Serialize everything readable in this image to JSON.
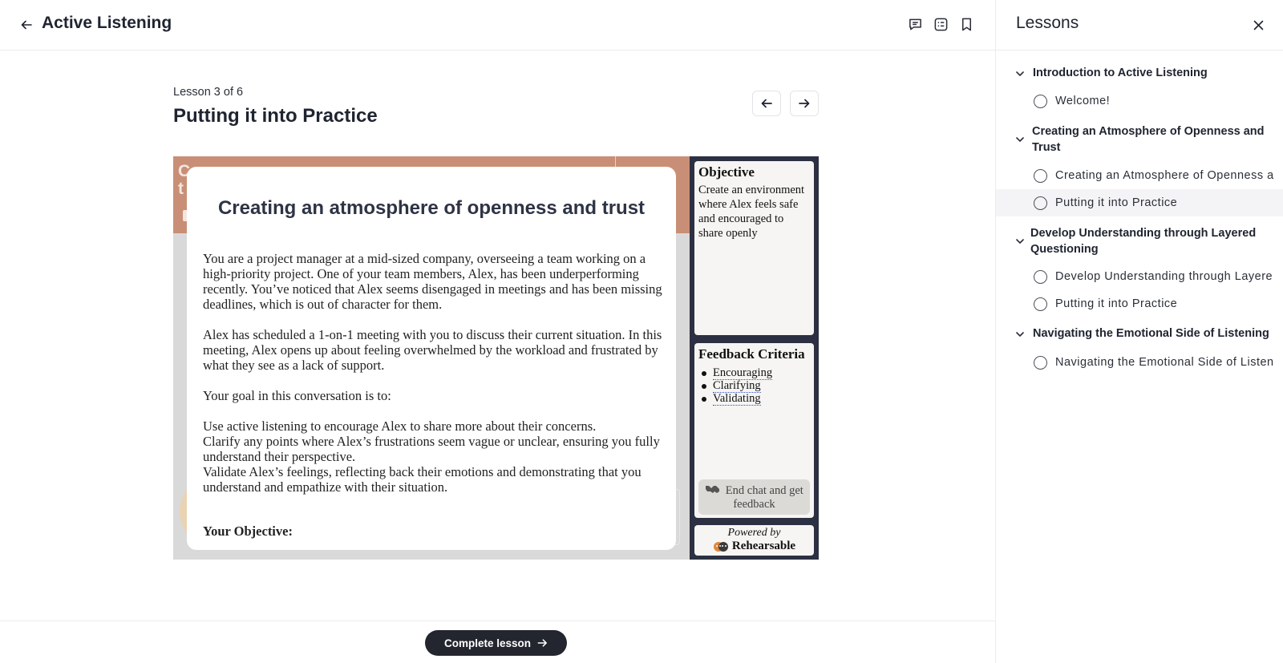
{
  "header": {
    "course_title": "Active Listening",
    "icons": [
      "back-arrow-icon",
      "comment-icon",
      "notes-icon",
      "bookmark-icon"
    ]
  },
  "lesson": {
    "count_label": "Lesson 3 of 6",
    "title": "Putting it into Practice"
  },
  "embed": {
    "background_text": "C",
    "background_text_2": "t",
    "modal": {
      "title": "Creating an atmosphere of openness and trust",
      "paragraphs": [
        "You are a project manager at a mid-sized company, overseeing a team working on a high-priority project. One of your team members, Alex, has been underperforming recently. You’ve noticed that Alex seems disengaged in meetings and has been missing deadlines, which is out of character for them.",
        "Alex has scheduled a 1-on-1 meeting with you to discuss their current situation. In this meeting, Alex opens up about feeling overwhelmed by the workload and frustrated by what they see as a lack of support.",
        "Your goal in this conversation is to:"
      ],
      "goals": [
        "Use active listening to encourage Alex to share more about their concerns.",
        "Clarify any points where Alex’s frustrations seem vague or unclear, ensuring you fully understand their perspective.",
        "Validate Alex’s feelings, reflecting back their emotions and demonstrating that you understand and empathize with their situation."
      ],
      "objective_heading": "Your Objective:"
    },
    "objective_card": {
      "heading": "Objective",
      "text": "Create an environment where Alex feels safe and encouraged to share openly"
    },
    "feedback_card": {
      "heading": "Feedback Criteria",
      "criteria": [
        "Encouraging",
        "Clarifying",
        "Validating"
      ],
      "end_button": "End chat and get feedback"
    },
    "powered": {
      "label": "Powered by",
      "brand": "Rehearsable"
    }
  },
  "footer": {
    "complete_label": "Complete lesson"
  },
  "sidebar": {
    "title": "Lessons",
    "sections": [
      {
        "label": "Introduction to Active Listening",
        "lessons": [
          {
            "label": "Welcome!",
            "active": false
          }
        ]
      },
      {
        "label": "Creating an Atmosphere of Openness and Trust",
        "lessons": [
          {
            "label": "Creating an Atmosphere of Openness a",
            "active": false
          },
          {
            "label": "Putting it into Practice",
            "active": true
          }
        ]
      },
      {
        "label": "Develop Understanding through Layered Questioning",
        "lessons": [
          {
            "label": "Develop Understanding through Layere",
            "active": false
          },
          {
            "label": "Putting it into Practice",
            "active": false
          }
        ]
      },
      {
        "label": "Navigating the Emotional Side of Listening",
        "lessons": [
          {
            "label": "Navigating the Emotional Side of Listen",
            "active": false
          }
        ]
      }
    ]
  }
}
